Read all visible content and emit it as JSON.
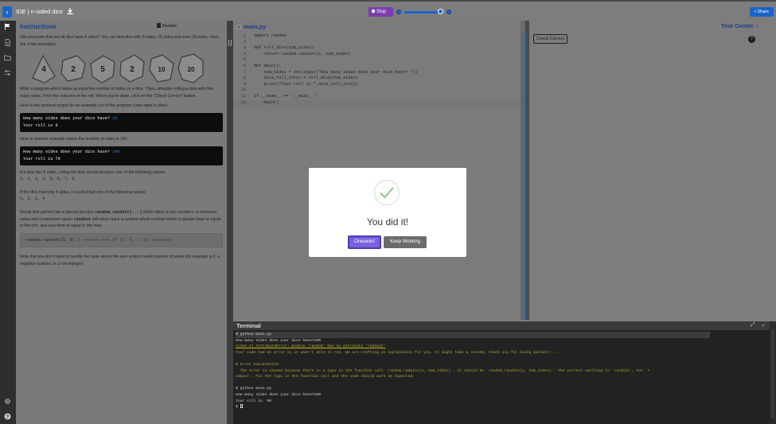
{
  "header": {
    "back_glyph": "‹",
    "breadcrumb": "IDE | n-sided dice",
    "download_icon": "download-icon",
    "stop_label": "Stop",
    "share_label": "Share",
    "speed_level": 0.9
  },
  "rail": {
    "icons": [
      "flag-icon",
      "file-icon",
      "folder-icon",
      "settings-sliders-icon",
      "gear-icon",
      "help-icon"
    ]
  },
  "instructions": {
    "title": "Instructions",
    "restart_label": "Restart",
    "intro": "Did you know that not all dice have 6 sides? You can find dice with 8 sides, 10 sides and even 20 sides. Here are a few examples:",
    "task": "Write a program which takes as input the number of sides on a dice. Then, simulate rolling a dice with that many sides. Print the outcome of the roll. When you're done, click on the \"Check Correct\" button.",
    "example1_label": "Here is the terminal output for an example run of the program (user input in blue):",
    "example1_prompt": "How many sides does your dice have? ",
    "example1_input": "10",
    "example1_result": "Your roll is 8",
    "example2_label": "Here is another example where the number of sides is 100:",
    "example2_prompt": "How many sides does your dice have? ",
    "example2_input": "100",
    "example2_result": "Your roll is 76",
    "eight_label": "If a dice has 8 sides, rolling the dice should produce one of the following values:",
    "eight_values": "1, 2, 3, 4, 5, 6, 7, 8",
    "four_label": "If the dice had only 4 sides, it could result one of the following values:",
    "four_values": "1, 2, 3, 4",
    "recall_a": "Recall that python has a special function ",
    "recall_fn": "random.randint(...)",
    "recall_b": " which takes in two numbers: a minimum value and a maximum value. ",
    "recall_fn2": "randint",
    "recall_c": " will return back a random whole number which is greater than or equal to the min, and less than or equal to the max:",
    "code_example": "random.randint(5, 8)",
    "code_comment": " # returns one of [5, 6, 7, 8] randomly",
    "note": "Note that you don't have to handle the case where the user enters invalid number of sides (for example a 0, a negative number, or a non-integer).",
    "dice_faces": [
      "4",
      "2",
      "5",
      "2",
      "10",
      "20"
    ]
  },
  "editor": {
    "filename": "main.py",
    "lines": [
      {
        "n": "1",
        "t": "import random"
      },
      {
        "n": "2",
        "t": ""
      },
      {
        "n": "3",
        "t": "def roll_dice(num_sides):"
      },
      {
        "n": "4",
        "t": "    return random.randint(1, num_sides)"
      },
      {
        "n": "5",
        "t": ""
      },
      {
        "n": "6",
        "t": "def main():"
      },
      {
        "n": "7",
        "t": "    num_sides = int(input(\"How many sides does your dice have? \"))"
      },
      {
        "n": "8",
        "t": "    dice_roll_total = roll_dice(num_sides)"
      },
      {
        "n": "9",
        "t": "    print(\"Your roll is \",dice_roll_total)"
      },
      {
        "n": "10",
        "t": ""
      },
      {
        "n": "11",
        "t": "if __name__ == '__main__':"
      },
      {
        "n": "12",
        "t": "    main()"
      }
    ]
  },
  "test_center": {
    "title": "Test Center",
    "check_label": "Check Correct",
    "help_glyph": "?"
  },
  "terminal": {
    "title": "Terminal",
    "lines": [
      "$ python main.py",
      "How many sides does your dice have?100",
      "(Line 4) AttributeError: module 'random' has no attribute 'radaint'",
      "Your code had an error so it wasn't able to run. We are crafting an explanation for you. It might take a second, thank you for being patient!...",
      "",
      "$ Error Explanation:",
      "  The error is caused because there is a typo in the function call `random.radaint(1, num_sides)`. It should be `random.randint(1, num_sides)`. The correct spelling is `randint`, not `r",
      "adaint`. Fix the typo in the function call and the code should work as expected.",
      "",
      "$ python main.py",
      "How many sides does your dice have?100",
      "Your roll is  96",
      "$ "
    ]
  },
  "modal": {
    "title": "You did it!",
    "onwards_label": "Onwards!",
    "keep_label": "Keep Working"
  }
}
